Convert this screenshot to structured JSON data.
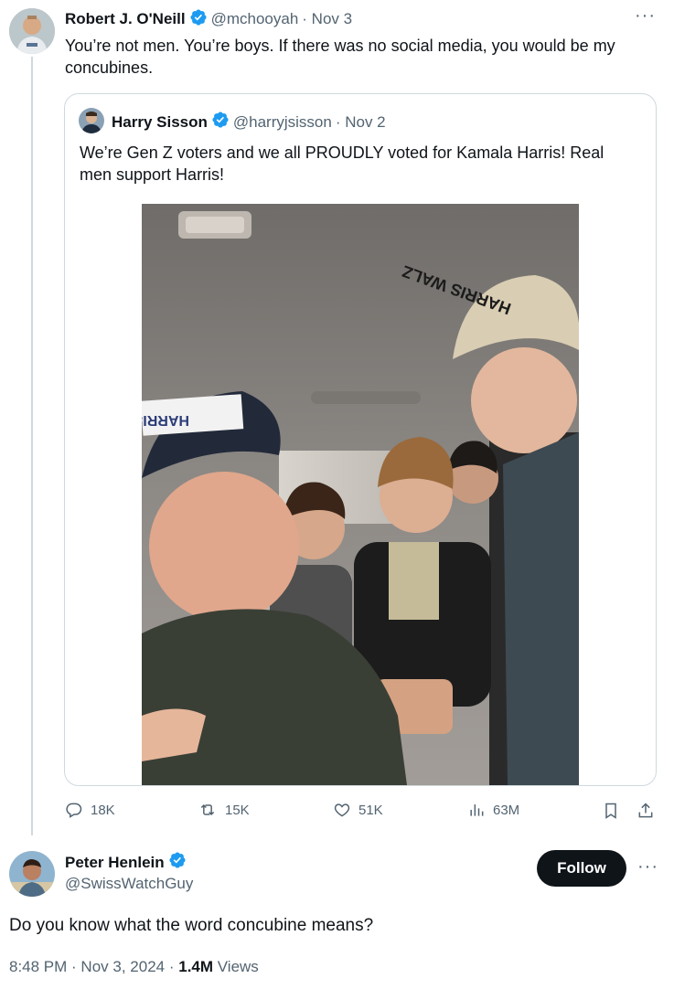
{
  "tweet": {
    "author_name": "Robert J. O'Neill",
    "handle": "@mchooyah",
    "date": "· Nov 3",
    "text_line1": "You’re not men. You’re boys. If there was no social media, you would be my",
    "text_line2": "concubines.",
    "more": "···"
  },
  "quote": {
    "author_name": "Harry Sisson",
    "handle": "@harryjsisson",
    "date": "· Nov 2",
    "text_line1": "We’re Gen Z voters and we all PROUDLY voted for Kamala Harris! Real",
    "text_line2": "men support Harris!",
    "hat_front_text": "HARRIS",
    "hat_right_text": "HARRIS WALZ"
  },
  "actions": {
    "replies": "18K",
    "reposts": "15K",
    "likes": "51K",
    "views": "63M"
  },
  "reply": {
    "author_name": "Peter Henlein",
    "handle": "@SwissWatchGuy",
    "follow_label": "Follow",
    "more": "···",
    "text": "Do you know what the word concubine means?",
    "time": "8:48 PM",
    "date": "· Nov 3, 2024 ·",
    "views_count": "1.4M",
    "views_label": "Views"
  },
  "colors": {
    "verified": "#1d9bf0",
    "line": "#cfd9de",
    "muted": "#536471"
  }
}
